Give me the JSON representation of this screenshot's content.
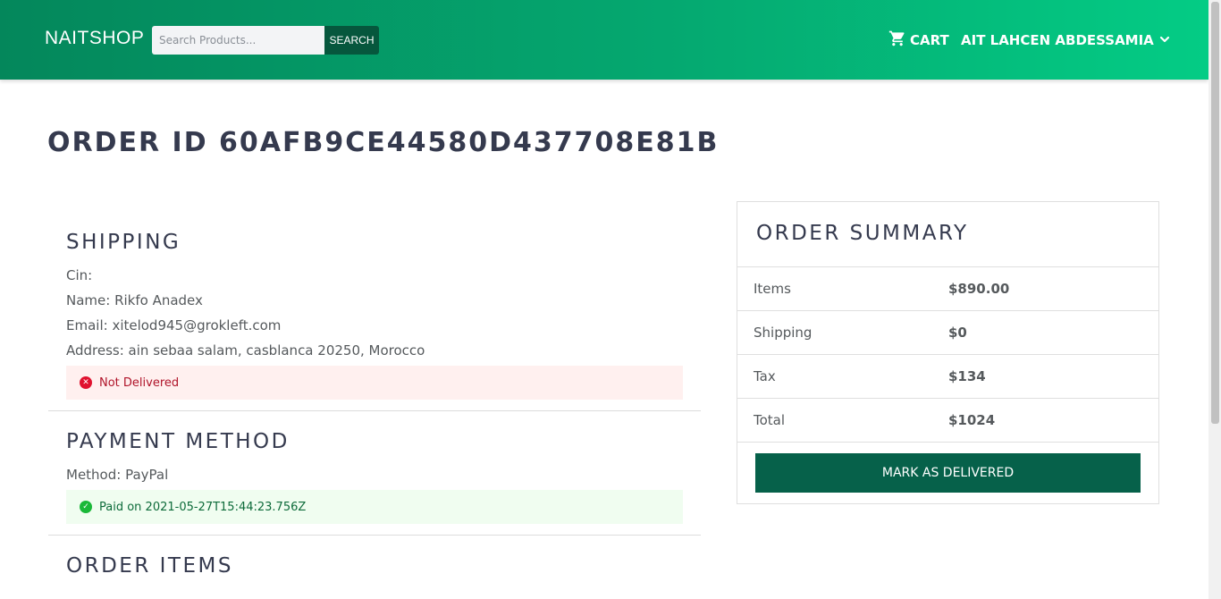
{
  "navbar": {
    "brand": "NAITSHOP",
    "search_placeholder": "Search Products...",
    "search_button": "SEARCH",
    "cart_label": "CART",
    "cart_icon": "cart-icon",
    "user_name": "AIT LAHCEN ABDESSAMIA",
    "user_dropdown_icon": "chevron-down-icon"
  },
  "order": {
    "title": "ORDER ID 60AFB9CE44580D437708E81B"
  },
  "shipping": {
    "heading": "SHIPPING",
    "cin": "Cin:",
    "name": "Name: Rikfo Anadex",
    "email": "Email: xitelod945@grokleft.com",
    "address": "Address: ain sebaa salam, casblanca 20250, Morocco",
    "status": "Not Delivered",
    "status_icon": "x-circle-icon"
  },
  "payment": {
    "heading": "PAYMENT METHOD",
    "method": "Method: PayPal",
    "status": "Paid on 2021-05-27T15:44:23.756Z",
    "status_icon": "check-circle-icon"
  },
  "order_items": {
    "heading": "ORDER ITEMS"
  },
  "summary": {
    "title": "ORDER SUMMARY",
    "rows": [
      {
        "label": "Items",
        "value": "$890.00"
      },
      {
        "label": "Shipping",
        "value": "$0"
      },
      {
        "label": "Tax",
        "value": "$134"
      },
      {
        "label": "Total",
        "value": "$1024"
      }
    ],
    "deliver_button": "MARK AS DELIVERED"
  },
  "colors": {
    "nav_gradient_start": "#04875b",
    "nav_gradient_end": "#04cc85",
    "primary_dark": "#06614a",
    "danger_bg": "#fff0ef",
    "success_bg": "#f0fdf0",
    "heading_text": "#353a4e"
  }
}
